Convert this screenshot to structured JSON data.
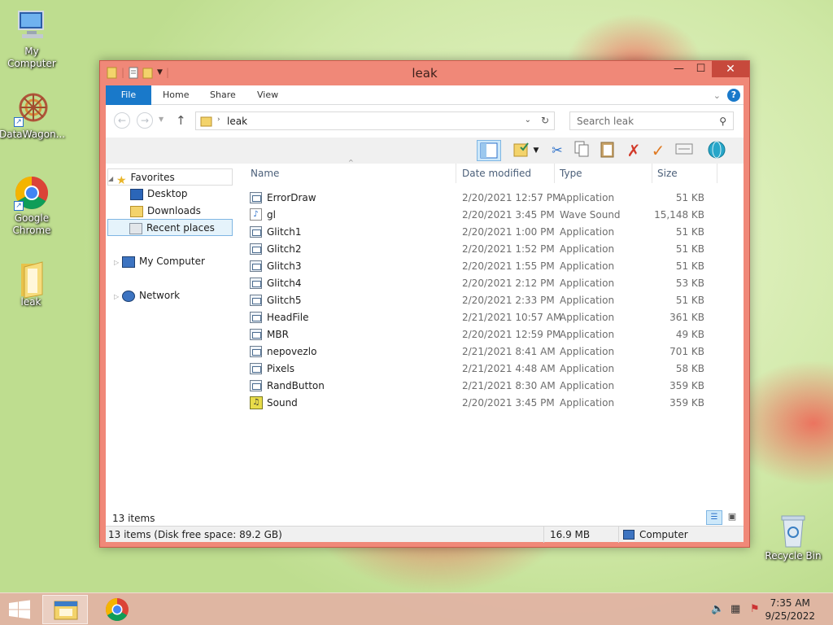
{
  "desktop": {
    "icons": [
      {
        "label": "My Computer"
      },
      {
        "label": "DataWagon..."
      },
      {
        "label": "Google Chrome"
      },
      {
        "label": "leak"
      },
      {
        "label": "Recycle Bin"
      }
    ]
  },
  "window": {
    "title": "leak",
    "ribbon_tabs": [
      "File",
      "Home",
      "Share",
      "View"
    ],
    "address": {
      "crumb": "leak"
    },
    "search": {
      "placeholder": "Search leak"
    },
    "nav": {
      "favorites": "Favorites",
      "desktop": "Desktop",
      "downloads": "Downloads",
      "recent": "Recent places",
      "computer": "My Computer",
      "network": "Network"
    },
    "columns": [
      "Name",
      "Date modified",
      "Type",
      "Size"
    ],
    "files": [
      {
        "name": "ErrorDraw",
        "date": "2/20/2021 12:57 PM",
        "type": "Application",
        "size": "51 KB",
        "icon": "app-icon"
      },
      {
        "name": "gl",
        "date": "2/20/2021 3:45 PM",
        "type": "Wave Sound",
        "size": "15,148 KB",
        "icon": "audio-icon"
      },
      {
        "name": "Glitch1",
        "date": "2/20/2021 1:00 PM",
        "type": "Application",
        "size": "51 KB",
        "icon": "app-icon"
      },
      {
        "name": "Glitch2",
        "date": "2/20/2021 1:52 PM",
        "type": "Application",
        "size": "51 KB",
        "icon": "app-icon"
      },
      {
        "name": "Glitch3",
        "date": "2/20/2021 1:55 PM",
        "type": "Application",
        "size": "51 KB",
        "icon": "app-icon"
      },
      {
        "name": "Glitch4",
        "date": "2/20/2021 2:12 PM",
        "type": "Application",
        "size": "53 KB",
        "icon": "app-icon"
      },
      {
        "name": "Glitch5",
        "date": "2/20/2021 2:33 PM",
        "type": "Application",
        "size": "51 KB",
        "icon": "app-icon"
      },
      {
        "name": "HeadFile",
        "date": "2/21/2021 10:57 AM",
        "type": "Application",
        "size": "361 KB",
        "icon": "app-icon"
      },
      {
        "name": "MBR",
        "date": "2/20/2021 12:59 PM",
        "type": "Application",
        "size": "49 KB",
        "icon": "app-icon"
      },
      {
        "name": "nepovezlo",
        "date": "2/21/2021 8:41 AM",
        "type": "Application",
        "size": "701 KB",
        "icon": "app-icon"
      },
      {
        "name": "Pixels",
        "date": "2/21/2021 4:48 AM",
        "type": "Application",
        "size": "58 KB",
        "icon": "app-icon"
      },
      {
        "name": "RandButton",
        "date": "2/21/2021 8:30 AM",
        "type": "Application",
        "size": "359 KB",
        "icon": "app-icon"
      },
      {
        "name": "Sound",
        "date": "2/20/2021 3:45 PM",
        "type": "Application",
        "size": "359 KB",
        "icon": "sound-app-icon"
      }
    ],
    "item_count": "13 items",
    "statusbar": {
      "left": "13 items (Disk free space: 89.2 GB)",
      "size": "16.9 MB",
      "location": "Computer"
    }
  },
  "taskbar": {
    "time": "7:35 AM",
    "date": "9/25/2022"
  },
  "colors": {
    "window_frame": "#f08878",
    "accent": "#1979ca",
    "close": "#c7493c"
  }
}
